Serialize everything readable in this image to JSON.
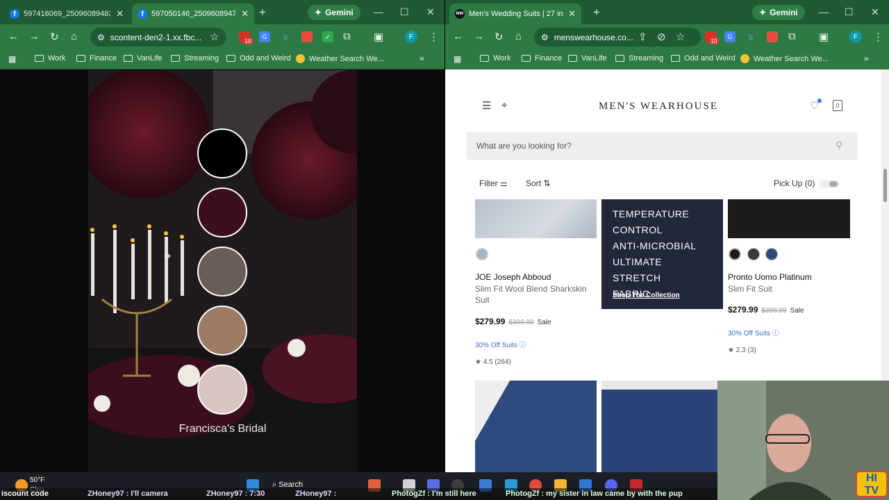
{
  "left_window": {
    "tabs": [
      {
        "title": "597416069_25096089483…",
        "active": false
      },
      {
        "title": "597050146_25096089476…",
        "active": true
      }
    ],
    "gemini": "Gemini",
    "url": "scontent-den2-1.xx.fbc...",
    "ext_badge": "10"
  },
  "right_window": {
    "tabs": [
      {
        "title": "Men's Wedding Suits | 27 in Sto…",
        "active": true
      }
    ],
    "gemini": "Gemini",
    "url": "menswearhouse.co...",
    "ext_badge": "10"
  },
  "bookmarks": [
    "Work",
    "Finance",
    "VanLife",
    "Streaming",
    "Odd and Weird",
    "Weather Search We..."
  ],
  "image": {
    "caption": "Francisca's Bridal",
    "swatches": [
      "#000000",
      "#3c0d1a",
      "#6a5d58",
      "#9c7c66",
      "#d9c6c2"
    ]
  },
  "site": {
    "logo": "MEN'S WEARHOUSE",
    "bag_count": "0",
    "search_placeholder": "What are you looking for?",
    "filter": "Filter",
    "sort": "Sort",
    "pickup": "Pick Up (0)",
    "promo": {
      "lines": [
        "TEMPERATURE",
        "CONTROL",
        "ANTI-MICROBIAL",
        "ULTIMATE STRETCH",
        "FABRIC"
      ],
      "link": "Shop The Collection"
    },
    "products": [
      {
        "brand": "JOE Joseph Abboud",
        "name": "Slim Fit Wool Blend Sharkskin Suit",
        "price": "$279.99",
        "was": "$399.99",
        "sale": "Sale",
        "offer": "30% Off Suits",
        "rating": "4.5 (264)",
        "colors": [
          "#a9b3c6"
        ]
      },
      {
        "brand": "Pronto Uomo Platinum",
        "name": "Slim Fit Suit",
        "price": "$279.99",
        "was": "$399.99",
        "sale": "Sale",
        "offer": "30% Off Suits",
        "rating": "2.3 (3)",
        "colors": [
          "#1b1b1b",
          "#3a3a3a",
          "#2c4a7a"
        ]
      }
    ]
  },
  "taskbar": {
    "weather_temp": "50°F",
    "weather_sub": "Clou",
    "search": "Search"
  },
  "ticker": [
    "iscount code",
    "ZHoney97 : I'll camera",
    "ZHoney97 : 7:30",
    "ZHoney97 :",
    "PhotogZf : I'm still here",
    "PhotogZf : my sister in law came by with the pup"
  ]
}
